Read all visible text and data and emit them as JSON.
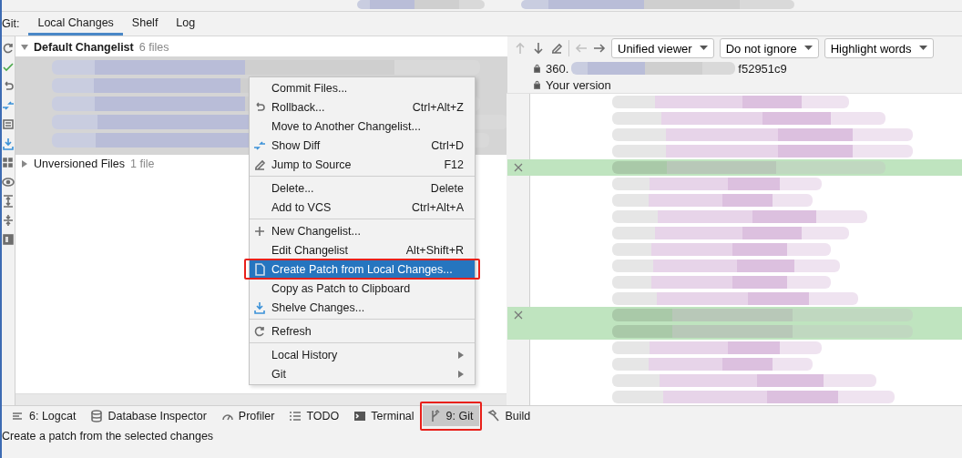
{
  "git_panel": {
    "label": "Git:",
    "tabs": [
      {
        "label": "Local Changes",
        "selected": true
      },
      {
        "label": "Shelf",
        "selected": false
      },
      {
        "label": "Log",
        "selected": false
      }
    ]
  },
  "changes_tree": {
    "groups": [
      {
        "name": "Default Changelist",
        "count": "6 files",
        "expanded": true,
        "bold": true
      },
      {
        "name": "Unversioned Files",
        "count": "1 file",
        "expanded": false,
        "bold": false
      }
    ]
  },
  "diff_toolbar": {
    "dropdowns": [
      "Unified viewer",
      "Do not ignore",
      "Highlight words"
    ]
  },
  "diff_header": {
    "revision_start": "360.",
    "revision_end": "f52951c9",
    "your_version": "Your version"
  },
  "context_menu": {
    "groups": [
      [
        {
          "label": "Commit Files...",
          "selected": false,
          "submenu": false
        },
        {
          "label": "Rollback...",
          "shortcut": "Ctrl+Alt+Z",
          "selected": false,
          "submenu": false
        },
        {
          "label": "Move to Another Changelist...",
          "selected": false,
          "submenu": false
        },
        {
          "label": "Show Diff",
          "shortcut": "Ctrl+D",
          "selected": false,
          "submenu": false
        },
        {
          "label": "Jump to Source",
          "shortcut": "F12",
          "selected": false,
          "submenu": false
        }
      ],
      [
        {
          "label": "Delete...",
          "shortcut": "Delete",
          "selected": false,
          "submenu": false
        },
        {
          "label": "Add to VCS",
          "shortcut": "Ctrl+Alt+A",
          "selected": false,
          "submenu": false
        }
      ],
      [
        {
          "label": "New Changelist...",
          "selected": false,
          "submenu": false
        },
        {
          "label": "Edit Changelist",
          "shortcut": "Alt+Shift+R",
          "selected": false,
          "submenu": false
        },
        {
          "label": "Create Patch from Local Changes...",
          "selected": true,
          "submenu": false
        },
        {
          "label": "Copy as Patch to Clipboard",
          "selected": false,
          "submenu": false
        },
        {
          "label": "Shelve Changes...",
          "selected": false,
          "submenu": false
        }
      ],
      [
        {
          "label": "Refresh",
          "selected": false,
          "submenu": false
        }
      ],
      [
        {
          "label": "Local History",
          "selected": false,
          "submenu": true
        },
        {
          "label": "Git",
          "selected": false,
          "submenu": true
        }
      ]
    ]
  },
  "tool_tabs": [
    {
      "label": "6: Logcat",
      "selected": false
    },
    {
      "label": "Database Inspector",
      "selected": false
    },
    {
      "label": "Profiler",
      "selected": false
    },
    {
      "label": "TODO",
      "selected": false
    },
    {
      "label": "Terminal",
      "selected": false
    },
    {
      "label": "9: Git",
      "selected": true
    },
    {
      "label": "Build",
      "selected": false
    }
  ],
  "status_bar": {
    "message": "Create a patch from the selected changes"
  }
}
